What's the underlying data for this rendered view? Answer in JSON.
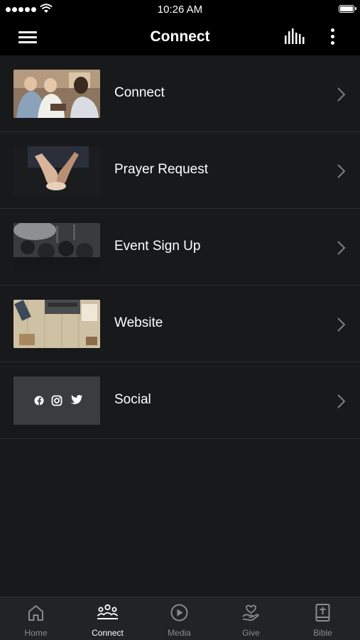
{
  "status_bar": {
    "time": "10:26 AM"
  },
  "header": {
    "title": "Connect"
  },
  "list_items": [
    {
      "label": "Connect"
    },
    {
      "label": "Prayer Request"
    },
    {
      "label": "Event Sign Up"
    },
    {
      "label": "Website"
    },
    {
      "label": "Social"
    }
  ],
  "social_icons": [
    "facebook-icon",
    "instagram-icon",
    "twitter-icon"
  ],
  "tab_bar": {
    "tabs": [
      {
        "label": "Home",
        "icon": "home-icon"
      },
      {
        "label": "Connect",
        "icon": "people-icon",
        "active": true
      },
      {
        "label": "Media",
        "icon": "play-icon"
      },
      {
        "label": "Give",
        "icon": "give-heart-icon"
      },
      {
        "label": "Bible",
        "icon": "bible-icon"
      }
    ]
  },
  "colors": {
    "background": "#18191b",
    "bar": "#000000",
    "tab_bar": "#222326",
    "active_tab": "#ffffff",
    "inactive_tab": "#8a8b8e"
  }
}
